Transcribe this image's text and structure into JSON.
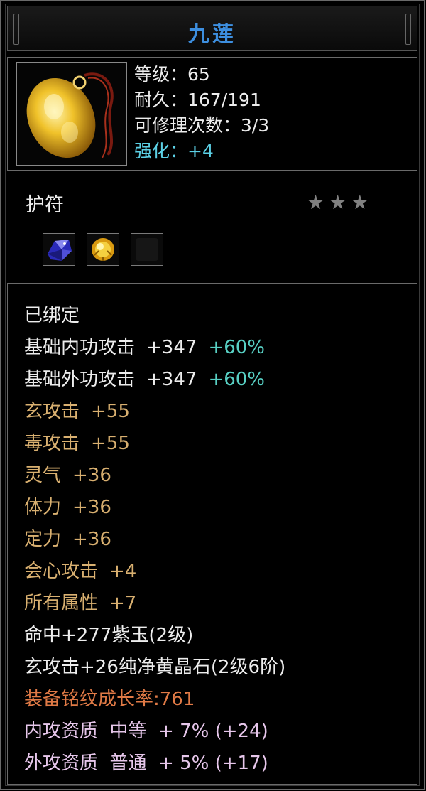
{
  "title": "九莲",
  "item": {
    "icon": "jade-amulet-icon",
    "info": [
      {
        "text": "等级：65",
        "color": "white"
      },
      {
        "text": "耐久：167/191",
        "color": "white"
      },
      {
        "text": "可修理次数：3/3",
        "color": "white"
      },
      {
        "text": "强化：+4",
        "color": "cyan"
      }
    ],
    "type": "护符",
    "stars": [
      "star-icon",
      "star-icon",
      "star-icon"
    ],
    "slots": [
      "blue-crystal-gem-icon",
      "gold-gem-icon",
      "empty-slot"
    ]
  },
  "attributes": {
    "bound": "已绑定",
    "lines": [
      {
        "label": "基础内功攻击",
        "value": "+347",
        "pct": "+60%",
        "color": "white"
      },
      {
        "label": "基础外功攻击",
        "value": "+347",
        "pct": "+60%",
        "color": "white"
      },
      {
        "label": "玄攻击",
        "value": "+55",
        "color": "tan"
      },
      {
        "label": "毒攻击",
        "value": "+55",
        "color": "tan"
      },
      {
        "label": "灵气",
        "value": "+36",
        "color": "tan"
      },
      {
        "label": "体力",
        "value": "+36",
        "color": "tan"
      },
      {
        "label": "定力",
        "value": "+36",
        "color": "tan"
      },
      {
        "label": "会心攻击",
        "value": "+4",
        "color": "tan"
      },
      {
        "label": "所有属性",
        "value": "+7",
        "color": "tan"
      }
    ],
    "gem_lines": [
      "命中+277紫玉(2级)",
      "玄攻击+26纯净黄晶石(2级6阶)"
    ],
    "growth": "装备铭纹成长率:761",
    "quality": [
      "内攻资质  中等  + 7% (+24)",
      "外攻资质  普通  + 5% (+17)"
    ]
  },
  "colors": {
    "title": "#3d8fe0",
    "cyan": "#5cd1e6",
    "tan": "#d9b070",
    "orange": "#e07a46",
    "pink": "#e6c6ea",
    "green": "#58d0c4"
  }
}
